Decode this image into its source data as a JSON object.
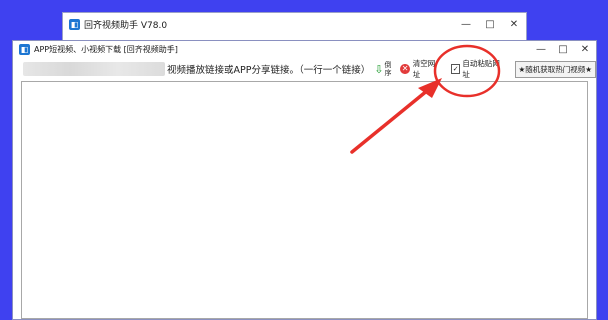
{
  "back_window": {
    "title": "回齐视频助手 V78.0",
    "icon": "app-logo-icon",
    "minimize": "—",
    "maximize": "□",
    "close": "✕"
  },
  "main_window": {
    "title": "APP短视频、小视频下载 [回齐视频助手]",
    "icon": "app-logo-icon",
    "minimize": "—",
    "maximize": "□",
    "close": "✕"
  },
  "toolbar": {
    "hint_text": "视频播放链接或APP分享链接。（一行一个链接）",
    "sort_icon": "down-arrow-icon",
    "sort_arrow": "⇩",
    "sort_label": "倒序",
    "clear_icon": "clear-icon",
    "clear_glyph": "✕",
    "clear_label": "清空网址",
    "auto_paste_checked": true,
    "auto_paste_check": "✓",
    "auto_paste_label": "自动粘贴网址",
    "hot_videos_label": "★随机获取热门视频★"
  },
  "annotation_color": "#e8302a"
}
